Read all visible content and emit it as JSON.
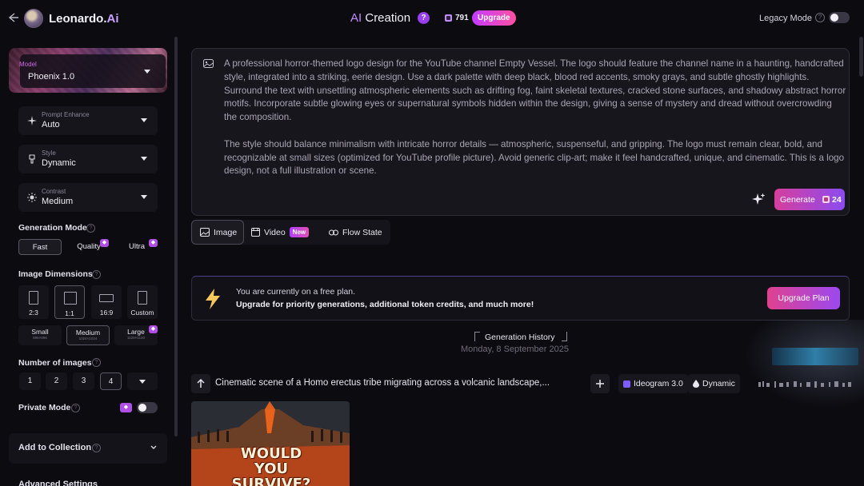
{
  "topbar": {
    "brand_name": "Leonardo.",
    "brand_suffix": "Ai",
    "title_prefix": "AI",
    "title_rest": " Creation",
    "help_glyph": "?",
    "token_count": "791",
    "upgrade_label": "Upgrade",
    "legacy_mode_label": "Legacy Mode",
    "legacy_mode_on": false
  },
  "sidebar": {
    "model": {
      "kicker": "Model",
      "value": "Phoenix 1.0"
    },
    "prompt_enhance": {
      "kicker": "Prompt Enhance",
      "value": "Auto"
    },
    "style": {
      "kicker": "Style",
      "value": "Dynamic"
    },
    "contrast": {
      "kicker": "Contrast",
      "value": "Medium"
    },
    "generation_mode": {
      "label": "Generation Mode",
      "options": [
        "Fast",
        "Quality",
        "Ultra"
      ],
      "selected": "Fast"
    },
    "image_dimensions": {
      "label": "Image Dimensions",
      "ratios": [
        "2:3",
        "1:1",
        "16:9",
        "Custom"
      ],
      "selected_ratio": "1:1",
      "sizes": [
        {
          "name": "Small",
          "px": "896×896"
        },
        {
          "name": "Medium",
          "px": "1024×1024"
        },
        {
          "name": "Large",
          "px": "1120×1120"
        }
      ],
      "selected_size": "Medium"
    },
    "number_of_images": {
      "label": "Number of images",
      "options": [
        "1",
        "2",
        "3",
        "4"
      ],
      "selected": "4"
    },
    "private_mode": {
      "label": "Private Mode",
      "on": false
    },
    "add_to_collection": {
      "label": "Add to Collection"
    },
    "advanced_settings": {
      "label": "Advanced Settings"
    }
  },
  "prompt": {
    "paragraph1": "A professional horror-themed logo design for the YouTube channel Empty Vessel. The logo should feature the channel name in a haunting, handcrafted style, integrated into a striking, eerie design. Use a dark palette with deep black, blood red accents, smoky grays, and subtle ghostly highlights. Surround the text with unsettling atmospheric elements such as drifting fog, faint skeletal textures, cracked stone surfaces, and shadowy abstract horror motifs. Incorporate subtle glowing eyes or supernatural symbols hidden within the design, giving a sense of mystery and dread without overcrowding the composition.",
    "paragraph2": "The style should balance minimalism with intricate horror details — atmospheric, suspenseful, and gripping. The logo must remain clear, bold, and recognizable at small sizes (optimized for YouTube profile picture). Avoid generic clip-art; make it feel handcrafted, unique, and cinematic. This is a logo design, not a full illustration or scene.",
    "generate_label": "Generate",
    "generate_cost": "24"
  },
  "tabs": {
    "image": "Image",
    "video": "Video",
    "video_badge": "New",
    "flow_state": "Flow State"
  },
  "plan_banner": {
    "line1": "You are currently on a free plan.",
    "line2": "Upgrade for priority generations, additional token credits, and much more!",
    "button": "Upgrade Plan"
  },
  "history": {
    "title": "Generation History",
    "date": "Monday, 8 September 2025",
    "item": {
      "prompt": "Cinematic scene of a Homo erectus tribe migrating across a volcanic landscape,...",
      "model": "Ideogram 3.0",
      "style": "Dynamic",
      "thumbnail_caption": "WOULD YOU SURVIVE?"
    }
  },
  "colors": {
    "background": "#0c0b10",
    "panel": "#17161d",
    "accent_purple": "#9b3df0",
    "accent_pink": "#d63f9d"
  }
}
